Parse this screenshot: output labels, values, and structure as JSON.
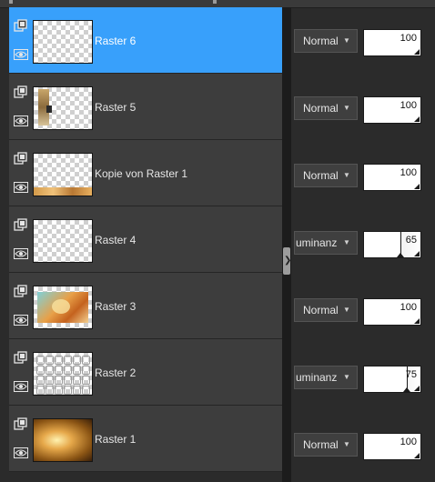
{
  "layers": [
    {
      "name": "Raster 6",
      "selected": true,
      "thumb": "transparent",
      "blend_mode": "Normal",
      "blend_truncated": false,
      "opacity": 100
    },
    {
      "name": "Raster 5",
      "selected": false,
      "thumb": "figure-left",
      "blend_mode": "Normal",
      "blend_truncated": false,
      "opacity": 100
    },
    {
      "name": "Kopie von Raster 1",
      "selected": false,
      "thumb": "bottom-strip",
      "blend_mode": "Normal",
      "blend_truncated": false,
      "opacity": 100
    },
    {
      "name": "Raster 4",
      "selected": false,
      "thumb": "transparent",
      "blend_mode": "uminanz (\\",
      "blend_truncated": true,
      "opacity": 65
    },
    {
      "name": "Raster 3",
      "selected": false,
      "thumb": "landscape",
      "blend_mode": "Normal",
      "blend_truncated": false,
      "opacity": 100
    },
    {
      "name": "Raster 2",
      "selected": false,
      "thumb": "pattern",
      "blend_mode": "uminanz (\\",
      "blend_truncated": true,
      "opacity": 75
    },
    {
      "name": "Raster 1",
      "selected": false,
      "thumb": "golden",
      "blend_mode": "Normal",
      "blend_truncated": false,
      "opacity": 100
    }
  ],
  "icons": {
    "group": "layer-group-icon",
    "visibility": "eye-icon",
    "dropdown": "chevron-down-icon",
    "splitter": "chevron-right-icon"
  },
  "colors": {
    "selected_row": "#38a0fb",
    "row": "#3d3d3d",
    "panel": "#2b2b2b"
  }
}
